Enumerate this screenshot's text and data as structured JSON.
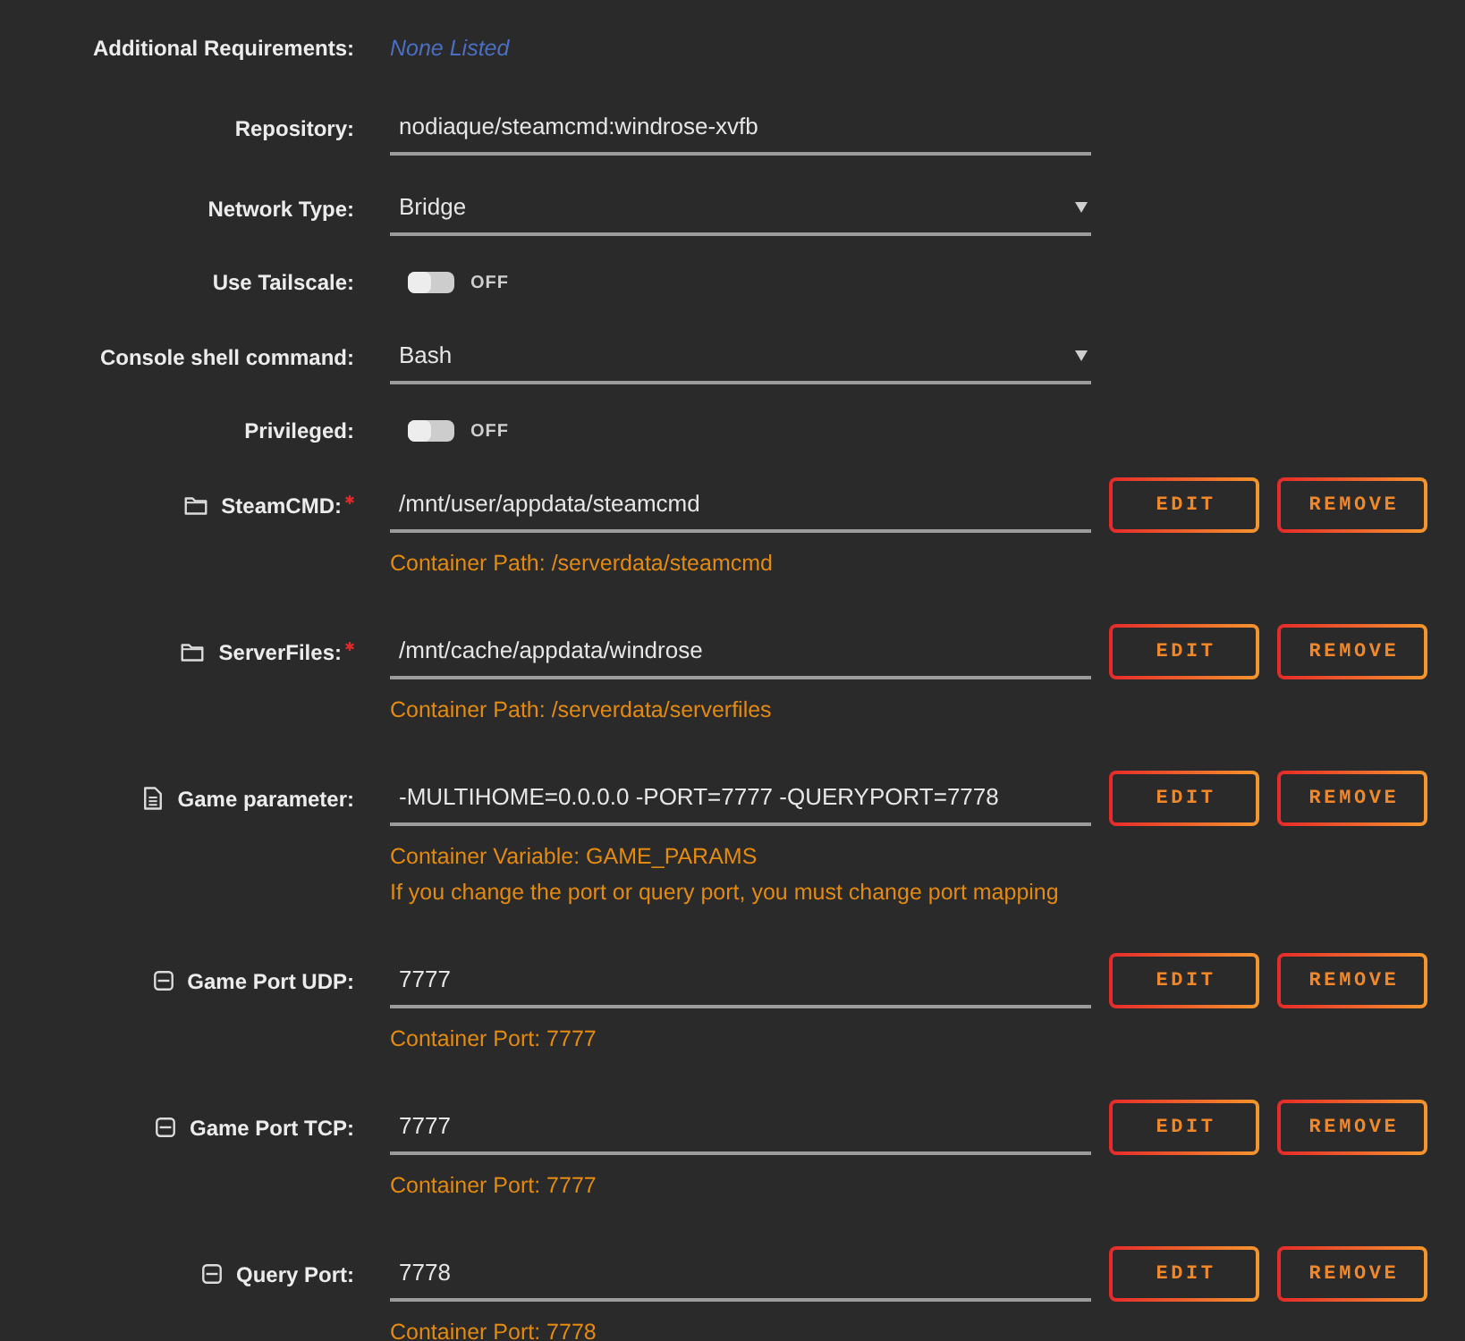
{
  "rows": [
    {
      "kind": "text",
      "label": "Additional Requirements:",
      "value": "None Listed"
    },
    {
      "kind": "input",
      "label": "Repository:",
      "value": "nodiaque/steamcmd:windrose-xvfb"
    },
    {
      "kind": "select",
      "label": "Network Type:",
      "value": "Bridge"
    },
    {
      "kind": "toggle",
      "label": "Use Tailscale:",
      "on": false,
      "state_label": "OFF"
    },
    {
      "kind": "select",
      "label": "Console shell command:",
      "value": "Bash"
    },
    {
      "kind": "toggle",
      "label": "Privileged:",
      "on": false,
      "state_label": "OFF"
    }
  ],
  "config": [
    {
      "kind": "path",
      "label": "SteamCMD:",
      "required": true,
      "value": "/mnt/user/appdata/steamcmd",
      "notes": [
        "Container Path: /serverdata/steamcmd"
      ],
      "edit_button": "EDIT",
      "remove_button": "REMOVE"
    },
    {
      "kind": "path",
      "label": "ServerFiles:",
      "required": true,
      "value": "/mnt/cache/appdata/windrose",
      "notes": [
        "Container Path: /serverdata/serverfiles"
      ],
      "edit_button": "EDIT",
      "remove_button": "REMOVE"
    },
    {
      "kind": "variable",
      "label": "Game parameter:",
      "required": false,
      "value": "-MULTIHOME=0.0.0.0 -PORT=7777 -QUERYPORT=7778",
      "notes": [
        "Container Variable: GAME_PARAMS",
        "If you change the port or query port, you must change port mapping"
      ],
      "edit_button": "EDIT",
      "remove_button": "REMOVE"
    },
    {
      "kind": "port",
      "label": "Game Port UDP:",
      "required": false,
      "value": "7777",
      "notes": [
        "Container Port: 7777"
      ],
      "edit_button": "EDIT",
      "remove_button": "REMOVE"
    },
    {
      "kind": "port",
      "label": "Game Port TCP:",
      "required": false,
      "value": "7777",
      "notes": [
        "Container Port: 7777"
      ],
      "edit_button": "EDIT",
      "remove_button": "REMOVE"
    },
    {
      "kind": "port",
      "label": "Query Port:",
      "required": false,
      "value": "7778",
      "notes": [
        "Container Port: 7778"
      ],
      "edit_button": "EDIT",
      "remove_button": "REMOVE"
    }
  ]
}
